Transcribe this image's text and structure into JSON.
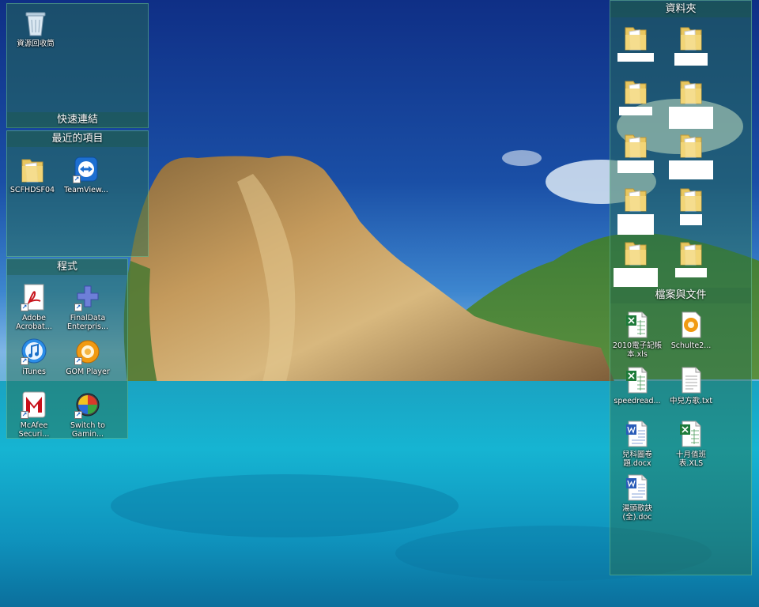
{
  "desktop": {
    "recycle_bin": {
      "label": "資源回收筒",
      "icon": "recycle-bin-icon"
    },
    "fences": {
      "quick_links": {
        "title": "快速連結"
      },
      "recent": {
        "title": "最近的項目",
        "items": [
          {
            "label": "SCFHDSF04",
            "icon": "folder-icon"
          },
          {
            "label": "TeamView...",
            "icon": "teamviewer-icon"
          }
        ]
      },
      "programs": {
        "title": "程式",
        "items": [
          {
            "label": "Adobe Acrobat...",
            "icon": "adobe-acrobat-icon"
          },
          {
            "label": "FinalData Enterpris...",
            "icon": "finaldata-icon"
          },
          {
            "label": "iTunes",
            "icon": "itunes-icon"
          },
          {
            "label": "GOM Player",
            "icon": "gom-player-icon"
          },
          {
            "label": "McAfee Securi...",
            "icon": "mcafee-icon"
          },
          {
            "label": "Switch to Gamin...",
            "icon": "switch-gaming-icon"
          }
        ]
      },
      "folders": {
        "title": "資料夾",
        "items": [
          {
            "label": "",
            "icon": "folder-icon"
          },
          {
            "label": "",
            "icon": "folder-icon"
          },
          {
            "label": "",
            "icon": "folder-icon"
          },
          {
            "label": "",
            "icon": "folder-icon"
          },
          {
            "label": "",
            "icon": "folder-icon"
          },
          {
            "label": "",
            "icon": "folder-icon"
          },
          {
            "label": "",
            "icon": "folder-icon"
          },
          {
            "label": "",
            "icon": "folder-icon"
          },
          {
            "label": "",
            "icon": "folder-icon"
          },
          {
            "label": "",
            "icon": "folder-icon"
          }
        ]
      },
      "documents": {
        "title": "檔案與文件",
        "items": [
          {
            "label": "2010電子記帳本.xls",
            "icon": "excel-file-icon"
          },
          {
            "label": "Schulte2...",
            "icon": "gom-file-icon"
          },
          {
            "label": "speedread...",
            "icon": "excel-file-icon"
          },
          {
            "label": "中兒方歌.txt",
            "icon": "text-file-icon"
          },
          {
            "label": "兒科圖卷題.docx",
            "icon": "word-file-icon"
          },
          {
            "label": "十月值班表.XLS",
            "icon": "excel-file-icon"
          },
          {
            "label": "湯頭歌訣(全).doc",
            "icon": "word-file-icon"
          }
        ]
      }
    }
  }
}
